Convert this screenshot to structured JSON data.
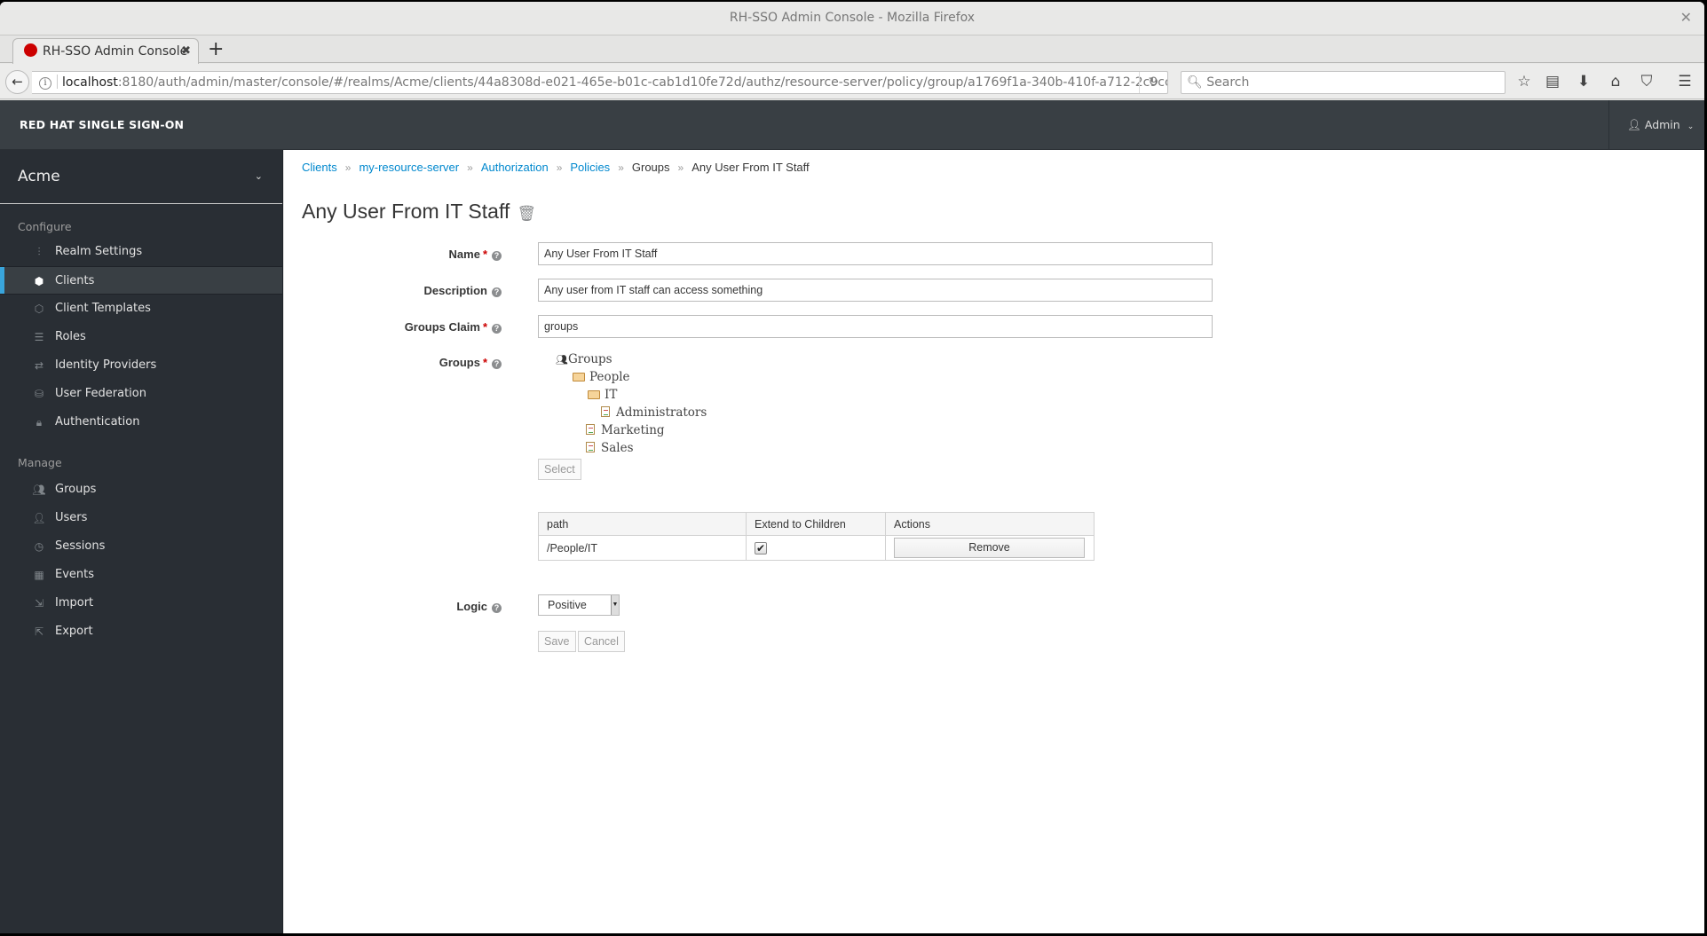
{
  "window": {
    "title": "RH-SSO Admin Console - Mozilla Firefox"
  },
  "browser": {
    "tab": {
      "label": "RH-SSO Admin Console"
    },
    "url": {
      "host": "localhost",
      "rest": ":8180/auth/admin/master/console/#/realms/Acme/clients/44a8308d-e021-465e-b01c-cab1d10fe72d/authz/resource-server/policy/group/a1769f1a-340b-410f-a712-2c9ccfb3cf0c"
    },
    "search_placeholder": "Search"
  },
  "header": {
    "brand": "RED HAT SINGLE SIGN-ON",
    "user": "Admin"
  },
  "sidebar": {
    "realm": "Acme",
    "configure_title": "Configure",
    "configure": [
      {
        "label": "Realm Settings",
        "icon": "sliders-icon"
      },
      {
        "label": "Clients",
        "icon": "cube-icon",
        "active": true
      },
      {
        "label": "Client Templates",
        "icon": "cubes-icon"
      },
      {
        "label": "Roles",
        "icon": "list-icon"
      },
      {
        "label": "Identity Providers",
        "icon": "exchange-icon"
      },
      {
        "label": "User Federation",
        "icon": "database-icon"
      },
      {
        "label": "Authentication",
        "icon": "lock-icon"
      }
    ],
    "manage_title": "Manage",
    "manage": [
      {
        "label": "Groups",
        "icon": "users-icon"
      },
      {
        "label": "Users",
        "icon": "user-icon"
      },
      {
        "label": "Sessions",
        "icon": "clock-icon"
      },
      {
        "label": "Events",
        "icon": "calendar-icon"
      },
      {
        "label": "Import",
        "icon": "import-icon"
      },
      {
        "label": "Export",
        "icon": "export-icon"
      }
    ]
  },
  "breadcrumb": [
    {
      "label": "Clients",
      "link": true
    },
    {
      "label": "my-resource-server",
      "link": true
    },
    {
      "label": "Authorization",
      "link": true
    },
    {
      "label": "Policies",
      "link": true
    },
    {
      "label": "Groups",
      "link": false
    },
    {
      "label": "Any User From IT Staff",
      "link": false
    }
  ],
  "page": {
    "title": "Any User From IT Staff"
  },
  "form": {
    "name": {
      "label": "Name",
      "value": "Any User From IT Staff",
      "required": true
    },
    "description": {
      "label": "Description",
      "value": "Any user from IT staff can access something",
      "required": false
    },
    "groups_claim": {
      "label": "Groups Claim",
      "value": "groups",
      "required": true
    },
    "groups": {
      "label": "Groups",
      "required": true
    },
    "tree": {
      "root": "Groups",
      "nodes": [
        {
          "label": "People",
          "type": "folder-open",
          "depth": 1
        },
        {
          "label": "IT",
          "type": "folder-open",
          "depth": 2
        },
        {
          "label": "Administrators",
          "type": "leaf",
          "depth": 3
        },
        {
          "label": "Marketing",
          "type": "leaf",
          "depth": 2
        },
        {
          "label": "Sales",
          "type": "leaf",
          "depth": 2
        }
      ]
    },
    "select_label": "Select",
    "table": {
      "headers": [
        "path",
        "Extend to Children",
        "Actions"
      ],
      "rows": [
        {
          "path": "/People/IT",
          "extend": true,
          "action": "Remove"
        }
      ]
    },
    "logic": {
      "label": "Logic",
      "value": "Positive"
    },
    "save_label": "Save",
    "cancel_label": "Cancel"
  }
}
